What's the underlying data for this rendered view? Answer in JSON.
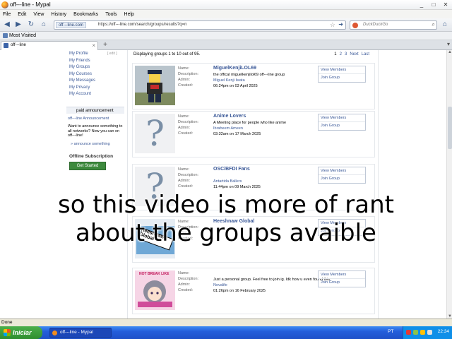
{
  "window": {
    "title": "off---line - Mypal",
    "buttons": [
      "_",
      "□",
      "✕"
    ]
  },
  "menu": [
    "File",
    "Edit",
    "View",
    "History",
    "Bookmarks",
    "Tools",
    "Help"
  ],
  "nav": {
    "site_identity": "off---line.com",
    "url": "https://off---line.com/search/groups/results?q=n",
    "search_engine": "DuckDuckGo"
  },
  "bookmarks": {
    "most_visited": "Most Visited"
  },
  "tab": {
    "label": "off---line"
  },
  "sidebar": {
    "edit": "[ edit ]",
    "links": [
      "My Profile",
      "My Friends",
      "My Groups",
      "My Courses",
      "My Messages",
      "My Privacy",
      "My Account"
    ],
    "paid_header": "paid announcement",
    "paid_link": "off---line Announcement",
    "paid_text": "Want to announce something to all networks? Now you can on off---line!",
    "announce_link": "» announce something",
    "subscription_header": "Offline Subscription",
    "get_started": "Get Started"
  },
  "results": {
    "display_text": "Displaying groups 1 to 10 out of 95.",
    "pager": {
      "current": "1",
      "pages": [
        "2",
        "3"
      ],
      "next": "Next",
      "last": "Last"
    }
  },
  "field_labels": {
    "name": "Name:",
    "description": "Description:",
    "admin": "Admin:",
    "created": "Created:"
  },
  "actions": {
    "view_members": "View Members",
    "join_group": "Join Group"
  },
  "groups": [
    {
      "name": "MiguelKenjiLOL69",
      "description": "the offical miguelkenjilol69 off---line group",
      "admin": "Miguel Kenji Iwata",
      "created": "06:24pm on 03 April 2025"
    },
    {
      "name": "Anime Lovers",
      "description": "A Meeting place for people who like anime",
      "admin": "Ibraheem Ameen",
      "created": "03:32am on 17 March 2025"
    },
    {
      "name": "OSC/BFDI Fans",
      "description": "",
      "admin": "Antartida Ballers",
      "created": "11:44pm on 09 March 2025"
    },
    {
      "name": "Heeshnaw Global",
      "description": "",
      "admin": "",
      "created": ""
    },
    {
      "name": "",
      "description": "Just a personal group. Feel free to join ig. Idk how u even found this.",
      "admin": "Novalife",
      "created": "01:26pm on 16 February 2025"
    }
  ],
  "thumb_texts": {
    "heeshnaw": "Heeshnaw Global",
    "anime": "NOT BREAK LIKE"
  },
  "caption": "so this video is more of rant about the groups avaible",
  "status": "Done",
  "taskbar": {
    "start": "Iniciar",
    "task": "off---line - Mypal",
    "lang": "PT",
    "clock": "22:34"
  }
}
